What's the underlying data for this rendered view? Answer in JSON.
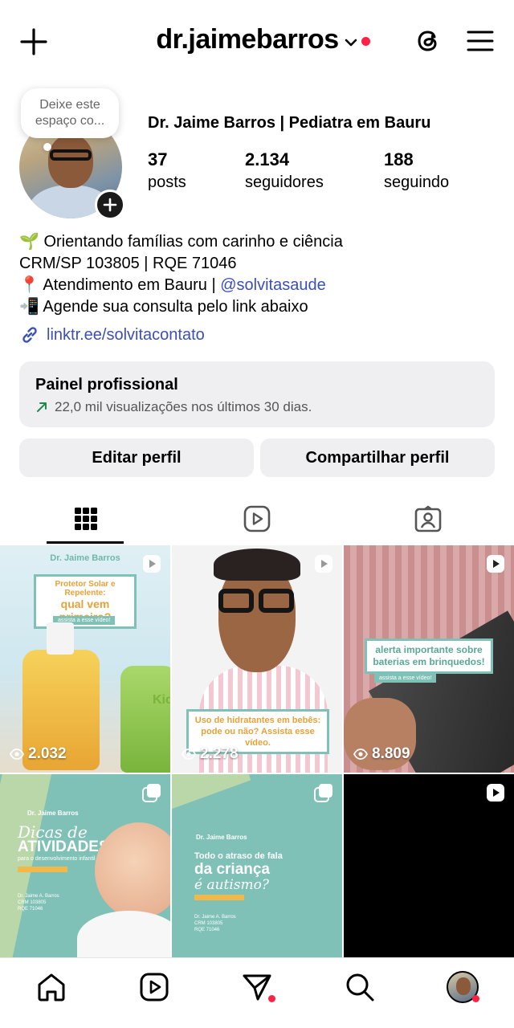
{
  "header": {
    "username": "dr.jaimebarros",
    "icons": [
      "plus-icon",
      "chevron-down-icon",
      "threads-icon",
      "menu-icon"
    ],
    "notification_color": "#ff2045"
  },
  "note": {
    "placeholder": "Deixe este espaço co..."
  },
  "profile": {
    "name": "Dr. Jaime Barros | Pediatra em Bauru",
    "stats": [
      {
        "value": "37",
        "label": "posts"
      },
      {
        "value": "2.134",
        "label": "seguidores"
      },
      {
        "value": "188",
        "label": "seguindo"
      }
    ]
  },
  "bio": {
    "line1_emoji": "🌱",
    "line1": "Orientando famílias com carinho e ciência",
    "line2": "CRM/SP 103805 | RQE 71046",
    "line3_emoji": "📍",
    "line3": "Atendimento em Bauru | ",
    "line3_mention": "@solvitasaude",
    "line4_emoji": "📲",
    "line4": "Agende sua consulta pelo link abaixo",
    "link": "linktr.ee/solvitacontato"
  },
  "panel": {
    "title": "Painel profissional",
    "subtitle": "22,0 mil visualizações nos últimos 30 dias."
  },
  "actions": {
    "edit": "Editar perfil",
    "share": "Compartilhar perfil"
  },
  "tabs": [
    "grid-icon",
    "reels-icon",
    "tagged-icon"
  ],
  "posts": [
    {
      "brand": "Dr. Jaime Barros",
      "caption": "Protetor Solar e Repelente:",
      "caption2": "qual vem primeiro?",
      "cta": "assista a esse vídeo!",
      "product": "Kid",
      "views": "2.032",
      "type": "reel"
    },
    {
      "caption": "Uso de hidratantes em bebês: pode ou não? Assista esse vídeo.",
      "views": "2.278",
      "type": "reel"
    },
    {
      "caption": "alerta importante sobre baterias em brinquedos!",
      "cta": "assista a esse vídeo!",
      "views": "8.809",
      "type": "reel"
    },
    {
      "brand": "Dr. Jaime Barros",
      "title1": "Dicas de",
      "title2": "ATIVIDADES",
      "title3": "para o desenvolvimento infantil",
      "doctor": "Dr. Jaime A. Barros",
      "crm": "CRM 103805",
      "rqe": "RQE 71046",
      "type": "carousel"
    },
    {
      "brand": "Dr. Jaime Barros",
      "title1": "Todo o atraso de fala",
      "title2": "da criança",
      "title3": "é autismo?",
      "doctor": "Dr. Jaime A. Barros",
      "crm": "CRM 103805",
      "rqe": "RQE 71046",
      "type": "carousel"
    },
    {
      "type": "reel"
    }
  ],
  "bottom_nav": [
    "home-icon",
    "reels-icon",
    "direct-icon",
    "search-icon",
    "profile-avatar"
  ]
}
